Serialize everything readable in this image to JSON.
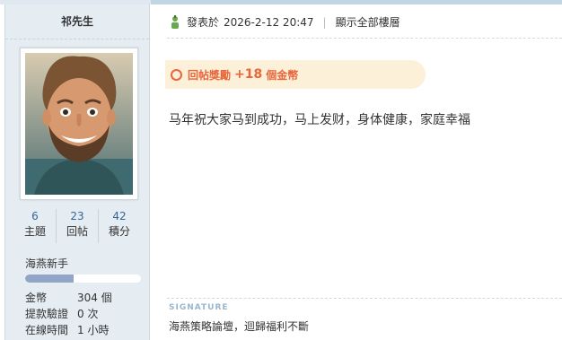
{
  "author": {
    "name": "祁先生"
  },
  "stats": [
    {
      "value": "6",
      "label": "主題"
    },
    {
      "value": "23",
      "label": "回帖"
    },
    {
      "value": "42",
      "label": "積分"
    }
  ],
  "rank": {
    "title": "海燕新手",
    "progress": 0.42
  },
  "info": [
    {
      "key": "金幣",
      "value": "304 個"
    },
    {
      "key": "提款驗證",
      "value": "0 次"
    },
    {
      "key": "在線時間",
      "value": "1 小時"
    }
  ],
  "post": {
    "posted_label": "發表於",
    "date": "2026-2-12 20:47",
    "show_all": "顯示全部樓層",
    "reward_text": "回帖獎勵",
    "reward_amount": "+18",
    "reward_unit": "個金幣",
    "message": "马年祝大家马到成功，马上发财，身体健康，家庭幸福"
  },
  "signature": {
    "label": "SIGNATURE",
    "text": "海燕策略論壇，迴歸福利不斷"
  },
  "colors": {
    "accent": "#e8663c",
    "link": "#336699",
    "reward_bg": "#fdf0d8",
    "sidebar_bg": "#e5edf2"
  },
  "icons": {
    "posted": "user-online-icon",
    "reward": "circle-icon"
  }
}
